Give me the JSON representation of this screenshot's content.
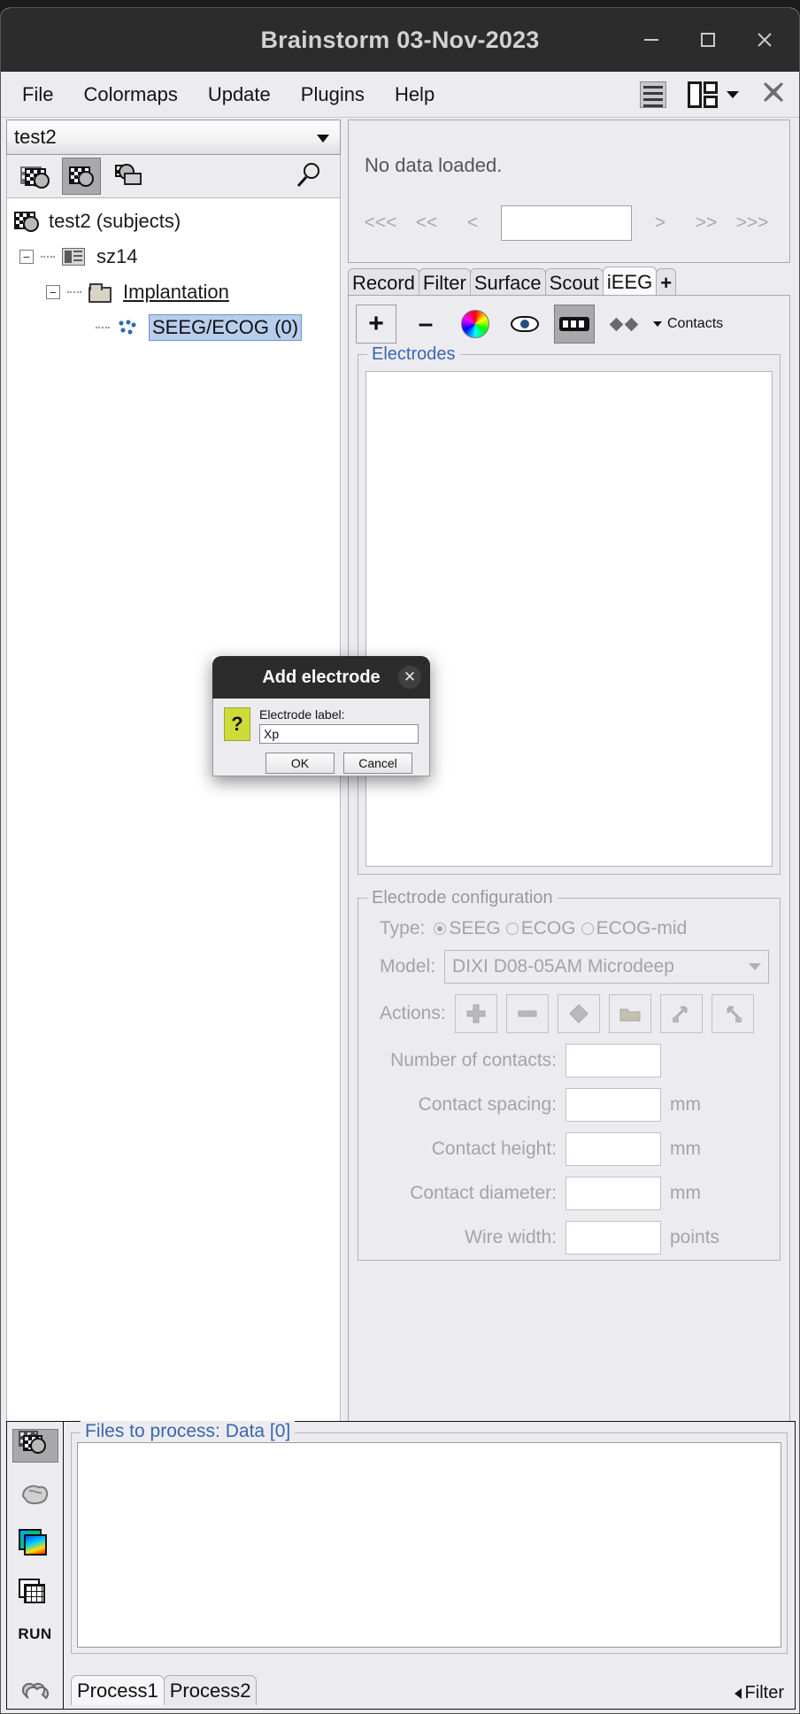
{
  "window": {
    "title": "Brainstorm 03-Nov-2023",
    "controls": {
      "minimize": "minimize-icon",
      "maximize": "maximize-icon",
      "close": "close-icon"
    }
  },
  "menubar": {
    "items": [
      "File",
      "Colormaps",
      "Update",
      "Plugins",
      "Help"
    ],
    "right_icons": [
      "panel-select-icon",
      "layout-icon",
      "layout-dropdown-caret",
      "close-all-icon"
    ]
  },
  "left_panel": {
    "protocol_combo": {
      "value": "test2"
    },
    "toolbar": [
      {
        "name": "anatomy-view-button",
        "pressed": false
      },
      {
        "name": "functional-subjects-view-button",
        "pressed": true
      },
      {
        "name": "functional-studies-view-button",
        "pressed": false
      }
    ],
    "search_icon": "magnifier-icon",
    "tree": [
      {
        "label": "test2 (subjects)",
        "icon": "protocol-icon",
        "depth": 0,
        "expander": "",
        "selected": false,
        "underline": false
      },
      {
        "label": "sz14",
        "icon": "subject-icon",
        "depth": 1,
        "expander": "minus",
        "selected": false,
        "underline": false
      },
      {
        "label": "Implantation",
        "icon": "folder-icon",
        "depth": 2,
        "expander": "minus",
        "selected": false,
        "underline": true
      },
      {
        "label": "SEEG/ECOG (0)",
        "icon": "seeg-icon",
        "depth": 3,
        "expander": "",
        "selected": true,
        "underline": false
      }
    ]
  },
  "right_panel": {
    "no_data_text": "No data loaded.",
    "nav_buttons": [
      "<<<",
      "<<",
      "<",
      ">",
      ">>",
      ">>>"
    ],
    "nav_field_value": "",
    "tabs": [
      {
        "label": "Record",
        "active": false
      },
      {
        "label": "Filter",
        "active": false
      },
      {
        "label": "Surface",
        "active": false
      },
      {
        "label": "Scout",
        "active": false
      },
      {
        "label": "iEEG",
        "active": true
      },
      {
        "label": "+",
        "active": false
      }
    ],
    "ieeg_toolbar": [
      {
        "name": "add-electrode-button",
        "glyph": "+",
        "pressed": false
      },
      {
        "name": "remove-electrode-button",
        "glyph": "–",
        "pressed": false
      },
      {
        "name": "electrode-color-button",
        "glyph": "color-wheel-icon",
        "pressed": false
      },
      {
        "name": "show-hide-electrodes-button",
        "glyph": "eye-icon",
        "pressed": false
      },
      {
        "name": "display-electrodes-button",
        "glyph": "electrode-icon",
        "pressed": true
      },
      {
        "name": "display-contacts-button",
        "glyph": "contacts-icon",
        "pressed": false
      }
    ],
    "contacts_menu_label": "Contacts",
    "electrodes_group_legend": "Electrodes",
    "config": {
      "legend": "Electrode configuration",
      "type_label": "Type:",
      "type_options": [
        {
          "label": "SEEG",
          "selected": true
        },
        {
          "label": "ECOG",
          "selected": false
        },
        {
          "label": "ECOG-mid",
          "selected": false
        }
      ],
      "model_label": "Model:",
      "model_value": "DIXI D08-05AM Microdeep",
      "actions_label": "Actions:",
      "actions": [
        "add-model-icon",
        "remove-model-icon",
        "edit-model-icon",
        "load-model-icon",
        "set-tip-icon",
        "set-entry-icon"
      ],
      "fields": [
        {
          "label": "Number of contacts:",
          "value": "",
          "unit": ""
        },
        {
          "label": "Contact spacing:",
          "value": "",
          "unit": "mm"
        },
        {
          "label": "Contact height:",
          "value": "",
          "unit": "mm"
        },
        {
          "label": "Contact diameter:",
          "value": "",
          "unit": "mm"
        },
        {
          "label": "Wire width:",
          "value": "",
          "unit": "points"
        }
      ]
    }
  },
  "bottom_panel": {
    "side_buttons": [
      {
        "name": "process-data-button",
        "pressed": true
      },
      {
        "name": "process-source-button",
        "pressed": false
      },
      {
        "name": "process-timefreq-button",
        "pressed": false
      },
      {
        "name": "process-matrix-button",
        "pressed": false
      }
    ],
    "run_label": "RUN",
    "link_icon": "pipeline-icon",
    "files_legend": "Files to process: Data [0]",
    "process_tabs": [
      {
        "label": "Process1",
        "active": true
      },
      {
        "label": "Process2",
        "active": false
      }
    ],
    "filter_label": "Filter"
  },
  "dialog": {
    "title": "Add electrode",
    "close_icon": "close-icon",
    "question_icon": "?",
    "field_label": "Electrode label:",
    "field_value": "Xp",
    "ok_label": "OK",
    "cancel_label": "Cancel"
  }
}
